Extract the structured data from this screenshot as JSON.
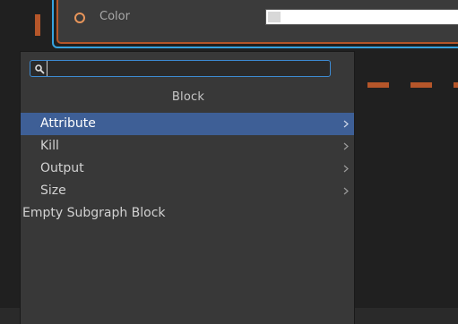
{
  "node": {
    "color_label": "Color"
  },
  "popup": {
    "search": {
      "value": "",
      "placeholder": ""
    },
    "header": "Block",
    "items": [
      {
        "label": "Attribute",
        "has_submenu": true,
        "selected": true
      },
      {
        "label": "Kill",
        "has_submenu": true,
        "selected": false
      },
      {
        "label": "Output",
        "has_submenu": true,
        "selected": false
      },
      {
        "label": "Size",
        "has_submenu": true,
        "selected": false
      },
      {
        "label": "Empty Subgraph Block",
        "has_submenu": false,
        "selected": false
      }
    ]
  },
  "colors": {
    "selection": "#3e5f96",
    "focus_border": "#3d8bd3",
    "node_border": "#b5562a",
    "node_selected_outline": "#36a3e0",
    "panel_bg": "#383838"
  },
  "icons": {
    "search": "search-icon",
    "submenu": "chevron-right-icon",
    "port": "port-ring-icon"
  }
}
